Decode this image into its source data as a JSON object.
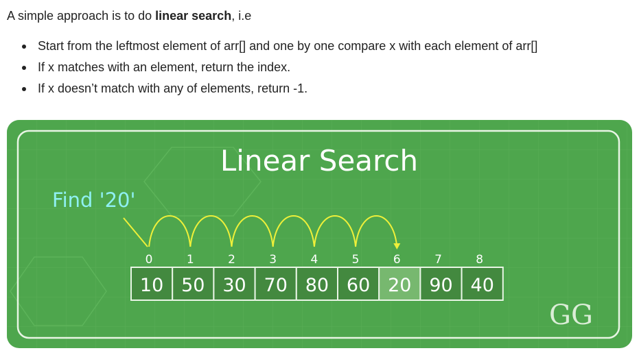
{
  "intro": {
    "prefix": "A simple approach is to do ",
    "bold": "linear search",
    "suffix": ", i.e"
  },
  "bullets": [
    "Start from the leftmost element of arr[] and one by one compare x with each element of arr[]",
    "If x matches with an element, return the index.",
    "If x doesn’t match with any of elements, return -1."
  ],
  "figure": {
    "title": "Linear Search",
    "find_label": "Find '20'",
    "array": {
      "indices": [
        "0",
        "1",
        "2",
        "3",
        "4",
        "5",
        "6",
        "7",
        "8"
      ],
      "values": [
        "10",
        "50",
        "30",
        "70",
        "80",
        "60",
        "20",
        "90",
        "40"
      ],
      "highlight_index": 6
    },
    "logo": "GG",
    "colors": {
      "background": "#4ea64d",
      "frame": "#e8f5e4",
      "title": "#ffffff",
      "find": "#8ff0f2",
      "arrow": "#eef03a",
      "cell": "#43893f",
      "cell_highlight": "#77b86f",
      "cell_border": "#e9f5e6"
    }
  }
}
